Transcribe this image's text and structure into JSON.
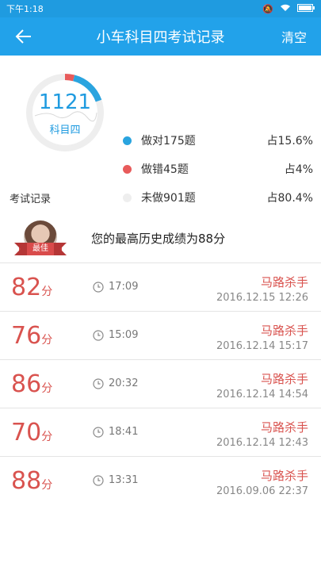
{
  "statusbar": {
    "time": "下午1:18",
    "icons": [
      "mute-icon",
      "wifi-icon",
      "battery-icon"
    ]
  },
  "header": {
    "title": "小车科目四考试记录",
    "clear_label": "清空"
  },
  "summary": {
    "total": "1121",
    "subject": "科目四",
    "legend": [
      {
        "label": "做对175题",
        "percent": "占15.6%",
        "color": "#2aa4df",
        "fraction": 0.156
      },
      {
        "label": "做错45题",
        "percent": "占4%",
        "color": "#e85b5b",
        "fraction": 0.04
      },
      {
        "label": "未做901题",
        "percent": "占80.4%",
        "color": "#eeeeee",
        "fraction": 0.804
      }
    ]
  },
  "section_title": "考试记录",
  "best": {
    "badge": "最佳",
    "text": "您的最高历史成绩为88分"
  },
  "records": [
    {
      "score": "82",
      "unit": "分",
      "duration": "17:09",
      "rank": "马路杀手",
      "date": "2016.12.15   12:26"
    },
    {
      "score": "76",
      "unit": "分",
      "duration": "15:09",
      "rank": "马路杀手",
      "date": "2016.12.14   15:17"
    },
    {
      "score": "86",
      "unit": "分",
      "duration": "20:32",
      "rank": "马路杀手",
      "date": "2016.12.14   14:54"
    },
    {
      "score": "70",
      "unit": "分",
      "duration": "18:41",
      "rank": "马路杀手",
      "date": "2016.12.14   12:43"
    },
    {
      "score": "88",
      "unit": "分",
      "duration": "13:31",
      "rank": "马路杀手",
      "date": "2016.09.06   22:37"
    }
  ]
}
